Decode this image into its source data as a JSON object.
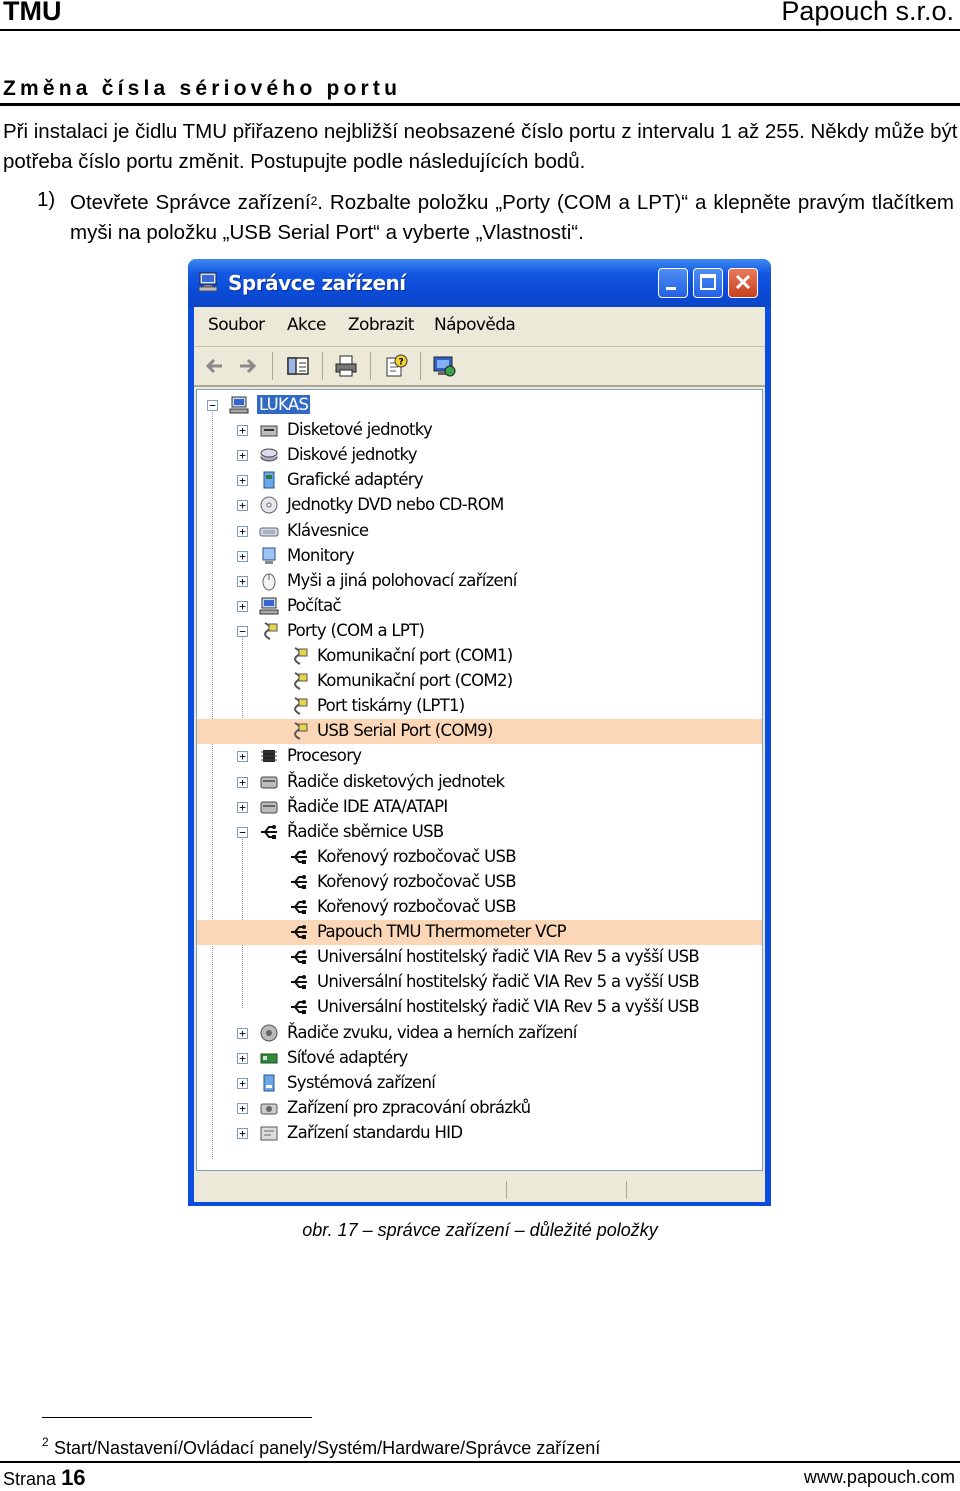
{
  "header": {
    "left": "TMU",
    "right": "Papouch s.r.o."
  },
  "section_title": "Změna čísla sériového portu",
  "intro": "Při instalaci je čidlu TMU přiřazeno nejbližší neobsazené číslo portu z intervalu 1 až 255. Někdy může být potřeba číslo portu změnit. Postupujte podle následujících bodů.",
  "step1": {
    "num": "1)",
    "text_a": "Otevřete Správce zařízení",
    "sup": "2",
    "text_b": ". Rozbalte položku „Porty (COM a LPT)“ a klepněte pravým tlačítkem myši na položku „USB Serial Port“ a vyberte „Vlastnosti“."
  },
  "window": {
    "title": "Správce zařízení",
    "menu": [
      "Soubor",
      "Akce",
      "Zobrazit",
      "Nápověda"
    ],
    "tree": [
      {
        "label": "LUKAS",
        "icon": "computer-icon",
        "level": 0,
        "expander": "-",
        "selected": true
      },
      {
        "label": "Disketové jednotky",
        "icon": "floppy-drive-icon",
        "level": 1,
        "expander": "+"
      },
      {
        "label": "Diskové jednotky",
        "icon": "disk-drive-icon",
        "level": 1,
        "expander": "+"
      },
      {
        "label": "Grafické adaptéry",
        "icon": "display-adapter-icon",
        "level": 1,
        "expander": "+"
      },
      {
        "label": "Jednotky DVD nebo CD-ROM",
        "icon": "cdrom-icon",
        "level": 1,
        "expander": "+"
      },
      {
        "label": "Klávesnice",
        "icon": "keyboard-icon",
        "level": 1,
        "expander": "+"
      },
      {
        "label": "Monitory",
        "icon": "monitor-icon",
        "level": 1,
        "expander": "+"
      },
      {
        "label": "Myši a jiná polohovací zařízení",
        "icon": "mouse-icon",
        "level": 1,
        "expander": "+"
      },
      {
        "label": "Počítač",
        "icon": "computer-icon",
        "level": 1,
        "expander": "+"
      },
      {
        "label": "Porty (COM a LPT)",
        "icon": "port-icon",
        "level": 1,
        "expander": "-"
      },
      {
        "label": "Komunikační port (COM1)",
        "icon": "port-icon",
        "level": 2
      },
      {
        "label": "Komunikační port (COM2)",
        "icon": "port-icon",
        "level": 2
      },
      {
        "label": "Port tiskárny (LPT1)",
        "icon": "port-icon",
        "level": 2
      },
      {
        "label": "USB Serial Port (COM9)",
        "icon": "port-icon",
        "level": 2,
        "highlight": true
      },
      {
        "label": "Procesory",
        "icon": "processor-icon",
        "level": 1,
        "expander": "+"
      },
      {
        "label": "Řadiče disketových jednotek",
        "icon": "controller-icon",
        "level": 1,
        "expander": "+"
      },
      {
        "label": "Řadiče IDE ATA/ATAPI",
        "icon": "controller-icon",
        "level": 1,
        "expander": "+"
      },
      {
        "label": "Řadiče sběrnice USB",
        "icon": "usb-icon",
        "level": 1,
        "expander": "-"
      },
      {
        "label": "Kořenový rozbočovač USB",
        "icon": "usb-icon",
        "level": 2
      },
      {
        "label": "Kořenový rozbočovač USB",
        "icon": "usb-icon",
        "level": 2
      },
      {
        "label": "Kořenový rozbočovač USB",
        "icon": "usb-icon",
        "level": 2
      },
      {
        "label": "Papouch TMU Thermometer VCP",
        "icon": "usb-icon",
        "level": 2,
        "highlight": true
      },
      {
        "label": "Universální hostitelský řadič VIA Rev 5 a vyšší USB",
        "icon": "usb-icon",
        "level": 2
      },
      {
        "label": "Universální hostitelský řadič VIA Rev 5 a vyšší USB",
        "icon": "usb-icon",
        "level": 2
      },
      {
        "label": "Universální hostitelský řadič VIA Rev 5 a vyšší USB",
        "icon": "usb-icon",
        "level": 2
      },
      {
        "label": "Řadiče zvuku, videa a herních zařízení",
        "icon": "sound-icon",
        "level": 1,
        "expander": "+"
      },
      {
        "label": "Síťové adaptéry",
        "icon": "network-card-icon",
        "level": 1,
        "expander": "+"
      },
      {
        "label": "Systémová zařízení",
        "icon": "system-device-icon",
        "level": 1,
        "expander": "+"
      },
      {
        "label": "Zařízení pro zpracování obrázků",
        "icon": "camera-icon",
        "level": 1,
        "expander": "+"
      },
      {
        "label": "Zařízení standardu HID",
        "icon": "hid-icon",
        "level": 1,
        "expander": "+"
      }
    ]
  },
  "caption": "obr. 17 – správce zařízení – důležité položky",
  "footnote": {
    "num": "2",
    "text": "Start/Nastavení/Ovládací panely/Systém/Hardware/Správce zařízení"
  },
  "footer": {
    "page_label": "Strana",
    "page_num": "16",
    "url": "www.papouch.com"
  }
}
